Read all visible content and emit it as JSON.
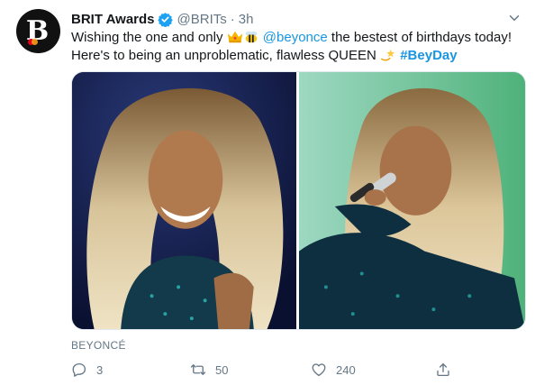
{
  "tweet": {
    "display_name": "BRIT Awards",
    "handle": "@BRITs",
    "separator": "·",
    "time": "3h",
    "avatar_letter": "B",
    "text": {
      "line1_pre": "Wishing the one and only ",
      "mention": "@beyonce",
      "line1_post": " the bestest of birthdays today!",
      "line2_pre": "Here's to being an unproblematic, flawless QUEEN ",
      "hashtag": "#BeyDay"
    },
    "emojis": [
      "crown-icon",
      "bee-icon",
      "dizzy-star-icon"
    ],
    "source_label": "BEYONCÉ",
    "actions": {
      "reply_count": "3",
      "retweet_count": "50",
      "like_count": "240"
    },
    "photos": [
      "beyonce-photo-left",
      "beyonce-photo-right"
    ]
  },
  "colors": {
    "link": "#1b95e0",
    "muted": "#657786",
    "verified": "#1da1f2",
    "text": "#14171a"
  }
}
